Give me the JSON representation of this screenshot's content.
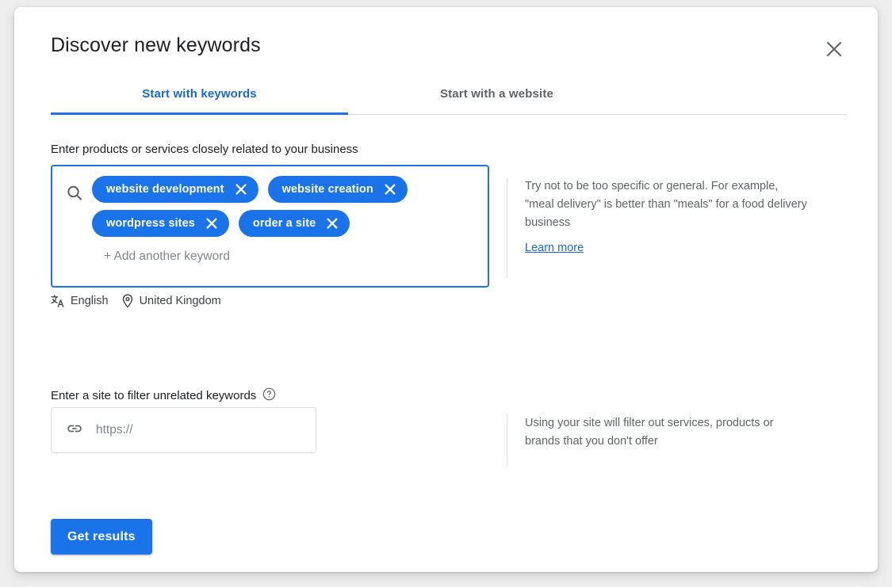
{
  "dialog": {
    "title": "Discover new keywords",
    "close_icon": "close-icon"
  },
  "tabs": [
    {
      "label": "Start with keywords",
      "active": true
    },
    {
      "label": "Start with a website",
      "active": false
    }
  ],
  "keywords_section": {
    "label": "Enter products or services closely related to your business",
    "search_icon": "search-icon",
    "chips": [
      {
        "label": "website development",
        "remove_icon": "close-icon"
      },
      {
        "label": "website creation",
        "remove_icon": "close-icon"
      },
      {
        "label": "wordpress sites",
        "remove_icon": "close-icon"
      },
      {
        "label": "order a site",
        "remove_icon": "close-icon"
      }
    ],
    "add_placeholder": "+ Add another keyword",
    "meta": {
      "language_icon": "translate-icon",
      "language": "English",
      "location_icon": "location-pin-icon",
      "location": "United Kingdom"
    },
    "hint": {
      "text": "Try not to be too specific or general. For example, \"meal delivery\" is better than \"meals\" for a food delivery business",
      "link": "Learn more"
    }
  },
  "site_section": {
    "label": "Enter a site to filter unrelated keywords",
    "help_icon": "help-circle-icon",
    "link_icon": "link-icon",
    "placeholder": "https://",
    "value": "",
    "hint": {
      "text": "Using your site will filter out services, products or brands that you don't offer"
    }
  },
  "submit": {
    "label": "Get results"
  },
  "colors": {
    "accent": "#1a73e8",
    "accent_dark": "#1967d2",
    "text_primary": "#202124",
    "text_secondary": "#5f6368",
    "border": "#dadce0",
    "page_background": "#eeeeee"
  }
}
